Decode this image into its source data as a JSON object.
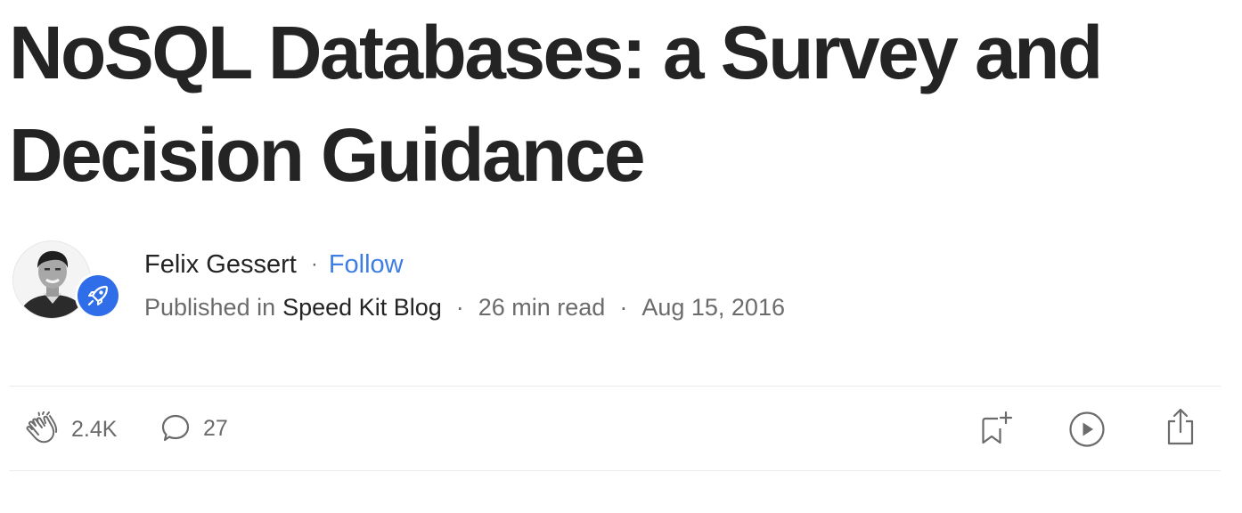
{
  "article": {
    "title_line1": "NoSQL Databases: a Survey and",
    "title_line2": "Decision Guidance"
  },
  "author": {
    "name": "Felix Gessert",
    "separator": "·",
    "follow_label": "Follow",
    "avatar_icon": "author-portrait",
    "publication_icon": "rocket-icon"
  },
  "publication": {
    "published_in_label": "Published in",
    "name": "Speed Kit Blog",
    "separator": "·",
    "read_time": "26 min read",
    "date": "Aug 15, 2016"
  },
  "actions": {
    "claps": "2.4K",
    "responses": "27",
    "clap_icon": "clap-icon",
    "response_icon": "speech-bubble-icon",
    "save_icon": "bookmark-add-icon",
    "listen_icon": "play-circle-icon",
    "share_icon": "share-icon"
  },
  "colors": {
    "text": "#242424",
    "muted": "#6b6b6b",
    "follow": "#3d7de4",
    "publication_badge": "#2f6ee8",
    "divider": "#ebebeb"
  }
}
